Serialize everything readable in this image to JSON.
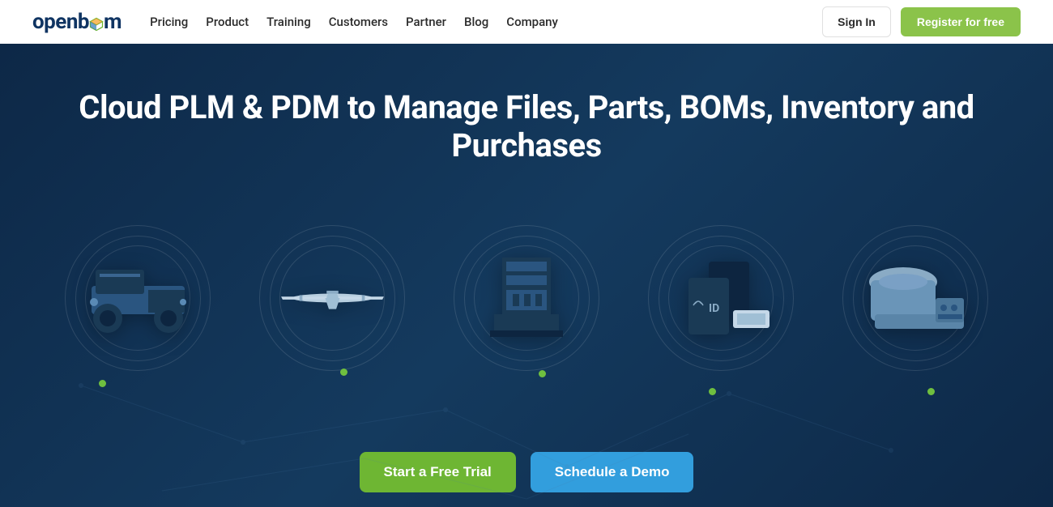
{
  "header": {
    "logo": {
      "part1": "openb",
      "part2": "m"
    },
    "nav": [
      {
        "label": "Pricing"
      },
      {
        "label": "Product"
      },
      {
        "label": "Training"
      },
      {
        "label": "Customers"
      },
      {
        "label": "Partner"
      },
      {
        "label": "Blog"
      },
      {
        "label": "Company"
      }
    ],
    "signin_label": "Sign In",
    "register_label": "Register for free"
  },
  "hero": {
    "title": "Cloud PLM & PDM to Manage Files, Parts, BOMs, Inventory and Purchases",
    "products": [
      {
        "name": "utility-vehicle"
      },
      {
        "name": "drone-aircraft"
      },
      {
        "name": "machinery"
      },
      {
        "name": "id-devices"
      },
      {
        "name": "medical-equipment"
      }
    ],
    "cta_trial": "Start a Free Trial",
    "cta_demo": "Schedule a Demo"
  }
}
